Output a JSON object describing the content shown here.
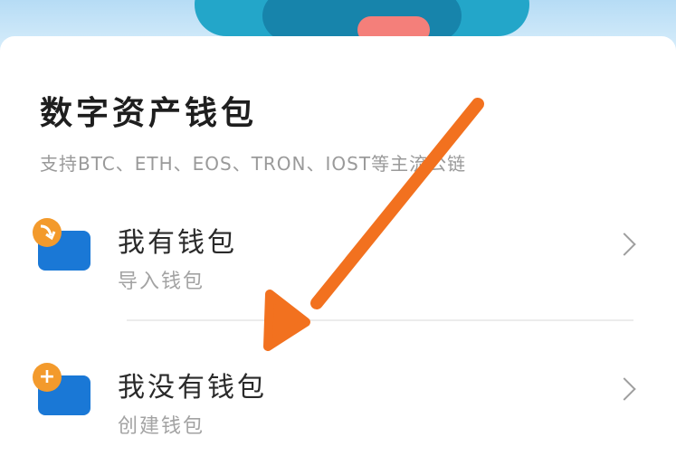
{
  "wallet": {
    "title": "数字资产钱包",
    "subtitle": "支持BTC、ETH、EOS、TRON、IOST等主流公链"
  },
  "options": [
    {
      "title": "我有钱包",
      "subtitle": "导入钱包",
      "icon": "import-wallet-icon",
      "badge": "",
      "badge_color": "#f39a2c",
      "icon_color": "#1a78d6"
    },
    {
      "title": "我没有钱包",
      "subtitle": "创建钱包",
      "icon": "create-wallet-icon",
      "badge": "+",
      "badge_color": "#f39a2c",
      "icon_color": "#1a78d6"
    }
  ],
  "colors": {
    "accent_arrow": "#f2711f",
    "hero_primary": "#23a6c9",
    "background": "#ffffff"
  }
}
